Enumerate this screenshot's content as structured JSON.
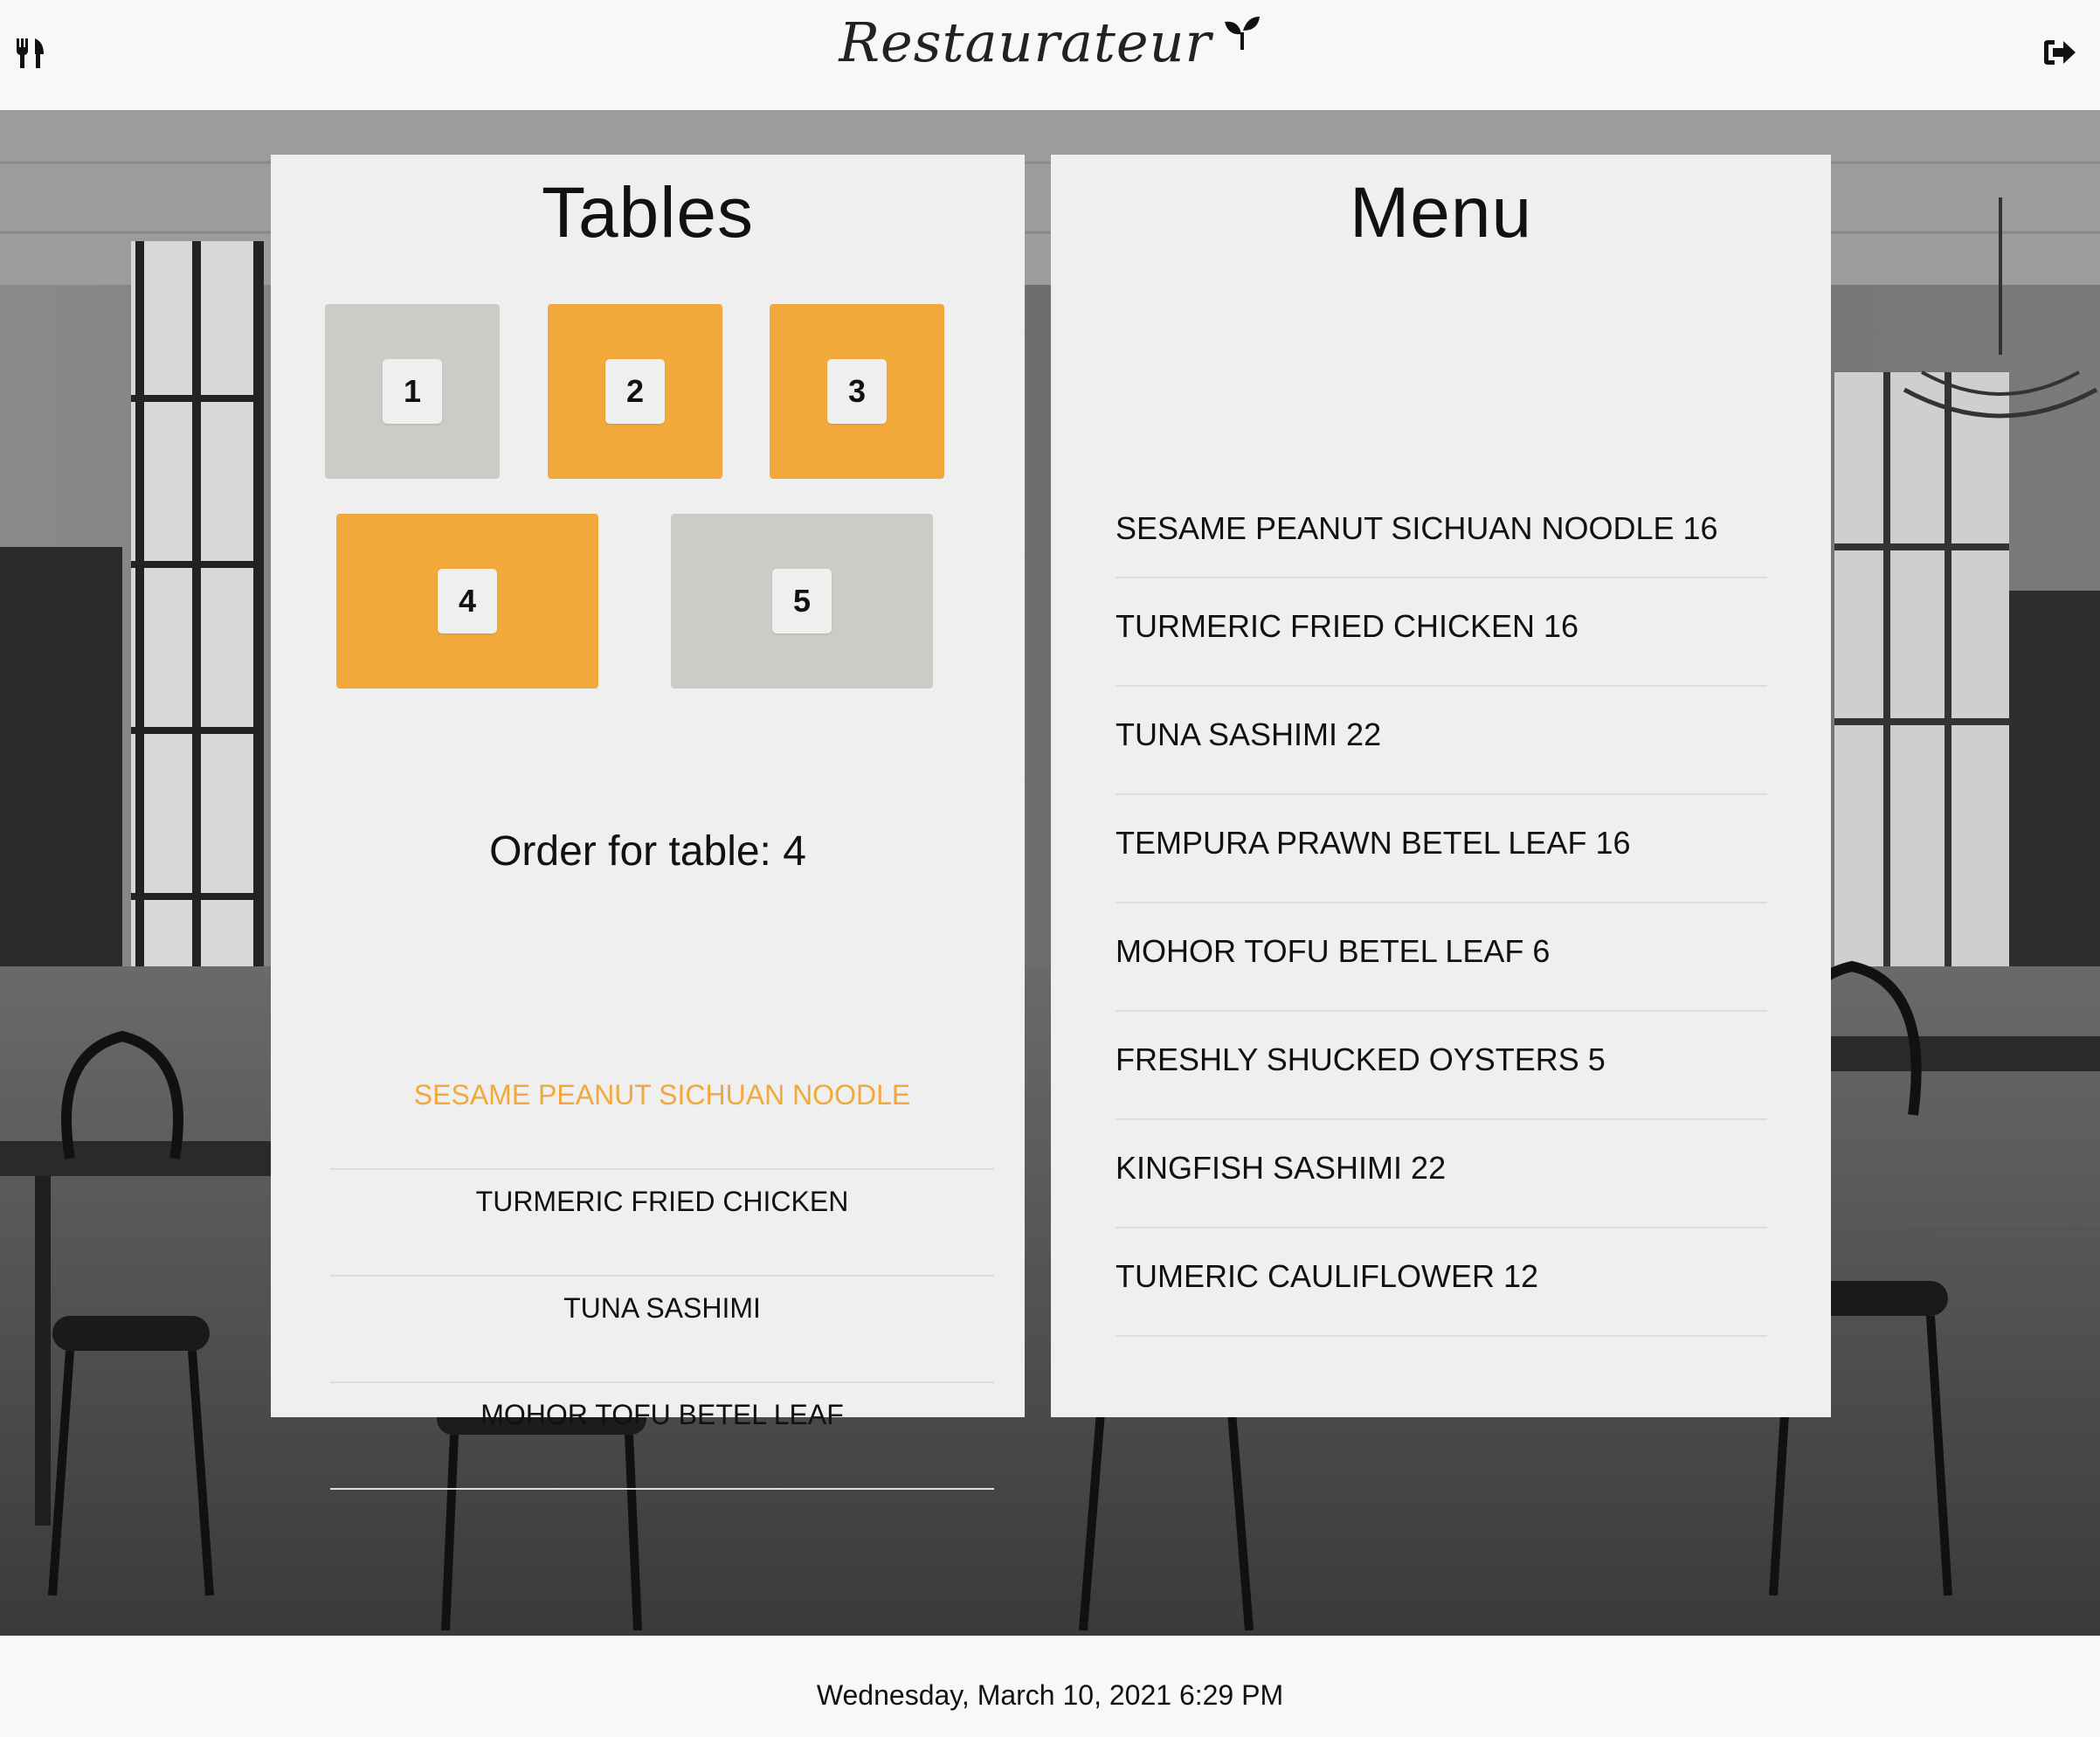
{
  "header": {
    "brand": "Restaurateur",
    "left_icon": "fork-knife-icon",
    "brand_icon": "leaf-icon",
    "right_icon": "logout-icon"
  },
  "tables_panel": {
    "title": "Tables",
    "tables": [
      {
        "number": "1",
        "status": "free"
      },
      {
        "number": "2",
        "status": "occupied"
      },
      {
        "number": "3",
        "status": "occupied"
      },
      {
        "number": "4",
        "status": "occupied"
      },
      {
        "number": "5",
        "status": "free"
      }
    ],
    "order_label": "Order for table: 4",
    "order_items": [
      {
        "name": "SESAME PEANUT SICHUAN NOODLE",
        "selected": true
      },
      {
        "name": "TURMERIC FRIED CHICKEN",
        "selected": false
      },
      {
        "name": "TUNA SASHIMI",
        "selected": false
      },
      {
        "name": "MOHOR TOFU BETEL LEAF",
        "selected": false
      }
    ]
  },
  "menu_panel": {
    "title": "Menu",
    "items": [
      {
        "name": "SESAME PEANUT SICHUAN NOODLE",
        "price": "16"
      },
      {
        "name": "TURMERIC FRIED CHICKEN",
        "price": "16"
      },
      {
        "name": "TUNA SASHIMI",
        "price": "22"
      },
      {
        "name": "TEMPURA PRAWN BETEL LEAF",
        "price": "16"
      },
      {
        "name": "MOHOR TOFU BETEL LEAF",
        "price": "6"
      },
      {
        "name": "FRESHLY SHUCKED OYSTERS",
        "price": "5"
      },
      {
        "name": "KINGFISH SASHIMI",
        "price": "22"
      },
      {
        "name": "TUMERIC CAULIFLOWER",
        "price": "12"
      }
    ]
  },
  "footer": {
    "datetime": "Wednesday, March 10, 2021 6:29 PM"
  },
  "colors": {
    "accent": "#f2a93b",
    "table_free": "#ccccc7",
    "panel_bg": "#efefef",
    "bar_bg": "#f7f8fa"
  }
}
